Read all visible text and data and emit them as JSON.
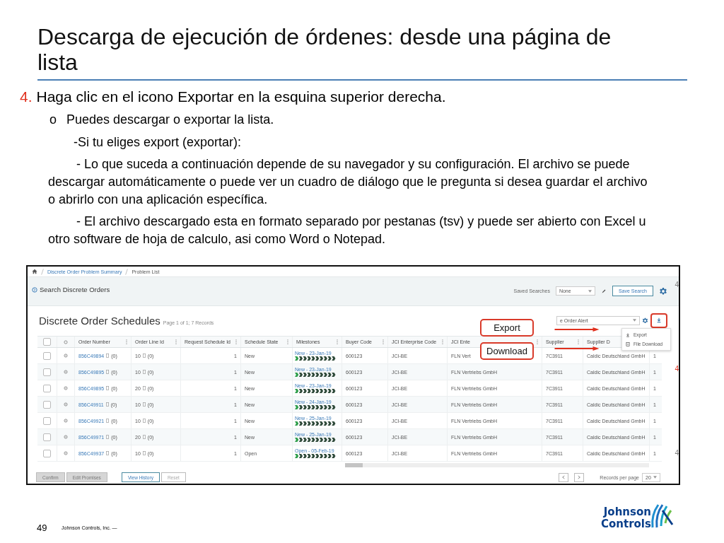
{
  "slide": {
    "title": "Descarga de ejecución de órdenes: desde una página de lista",
    "steps": [
      {
        "kind": "numbered",
        "marker": "4.",
        "text": "Haga clic en el icono Exportar en la esquina superior derecha."
      },
      {
        "kind": "bullet",
        "marker": "o",
        "text": "Puedes descargar o exportar la lista."
      },
      {
        "kind": "indent",
        "text": "-Si tu eliges export (exportar):"
      },
      {
        "kind": "paragraph",
        "text": "- Lo que suceda a continuación depende de su navegador y su configuración. El archivo se puede descargar automáticamente o puede ver un cuadro de diálogo que le pregunta si desea guardar el archivo o abrirlo con una aplicación específica."
      },
      {
        "kind": "paragraph",
        "text": "- El archivo descargado esta en formato separado por pestanas (tsv) y puede ser abierto con Excel u otro software de hoja de calculo, asi como Word o Notepad."
      }
    ]
  },
  "screenshot": {
    "breadcrumbs": [
      "Discrete Order Problem Summary",
      "Problem List"
    ],
    "search_panel": {
      "title": "Search Discrete Orders",
      "saved_searches_label": "Saved Searches",
      "saved_search": "None",
      "save_button": "Save Search"
    },
    "list": {
      "title": "Discrete Order Schedules",
      "page_info": "Page 1 of 1; 7 Records",
      "view_select": "e Order Alert",
      "columns": [
        "Order Number",
        "Order Line Id",
        "Request Schedule Id",
        "Schedule State",
        "Milestones",
        "Buyer Code",
        "JCI Enterprise Code",
        "JCI Ente",
        "Supplier",
        "Supplier D"
      ],
      "header_checked": false,
      "rows": [
        {
          "checked": false,
          "order_number": "856C49894",
          "order_count": "(0)",
          "line_id": "10",
          "line_count": "(0)",
          "request_schedule_id": "1",
          "state": "New",
          "milestone": "New - 23-Jan-19",
          "buyer_code": "600123",
          "enterprise_code": "JCI-BE",
          "enterprise_description": "FLN Vert",
          "supplier": "7C3911",
          "supplier_description": "Caldic Deutschland GmbH",
          "column_13": "1"
        },
        {
          "checked": false,
          "order_number": "856C49895",
          "order_count": "(0)",
          "line_id": "10",
          "line_count": "(0)",
          "request_schedule_id": "1",
          "state": "New",
          "milestone": "New - 23-Jan-19",
          "buyer_code": "600123",
          "enterprise_code": "JCI-BE",
          "enterprise_description": "FLN Vertriebs GmbH",
          "supplier": "7C3911",
          "supplier_description": "Caldic Deutschland GmbH",
          "column_13": "1"
        },
        {
          "checked": false,
          "order_number": "856C49895",
          "order_count": "(0)",
          "line_id": "20",
          "line_count": "(0)",
          "request_schedule_id": "1",
          "state": "New",
          "milestone": "New - 23-Jan-19",
          "buyer_code": "600123",
          "enterprise_code": "JCI-BE",
          "enterprise_description": "FLN Vertriebs GmbH",
          "supplier": "7C3911",
          "supplier_description": "Caldic Deutschland GmbH",
          "column_13": "1"
        },
        {
          "checked": false,
          "order_number": "856C49911",
          "order_count": "(0)",
          "line_id": "10",
          "line_count": "(0)",
          "request_schedule_id": "1",
          "state": "New",
          "milestone": "New - 24-Jan-19",
          "buyer_code": "600123",
          "enterprise_code": "JCI-BE",
          "enterprise_description": "FLN Vertriebs GmbH",
          "supplier": "7C3911",
          "supplier_description": "Caldic Deutschland GmbH",
          "column_13": "1"
        },
        {
          "checked": false,
          "order_number": "856C49921",
          "order_count": "(0)",
          "line_id": "10",
          "line_count": "(0)",
          "request_schedule_id": "1",
          "state": "New",
          "milestone": "New - 25-Jan-19",
          "buyer_code": "600123",
          "enterprise_code": "JCI-BE",
          "enterprise_description": "FLN Vertriebs GmbH",
          "supplier": "7C3911",
          "supplier_description": "Caldic Deutschland GmbH",
          "column_13": "1"
        },
        {
          "checked": false,
          "order_number": "856C49971",
          "order_count": "(0)",
          "line_id": "20",
          "line_count": "(0)",
          "request_schedule_id": "1",
          "state": "New",
          "milestone": "New - 25-Jan-19",
          "buyer_code": "600123",
          "enterprise_code": "JCI-BE",
          "enterprise_description": "FLN Vertriebs GmbH",
          "supplier": "7C3911",
          "supplier_description": "Caldic Deutschland GmbH",
          "column_13": "1"
        },
        {
          "checked": false,
          "order_number": "856C49937",
          "order_count": "(0)",
          "line_id": "10",
          "line_count": "(0)",
          "request_schedule_id": "1",
          "state": "Open",
          "milestone": "Open - 05-Feb-19",
          "buyer_code": "600123",
          "enterprise_code": "JCI-BE",
          "enterprise_description": "FLN Vertriebs GmbH",
          "supplier": "7C3911",
          "supplier_description": "Caldic Deutschland GmbH",
          "column_13": "1"
        }
      ]
    },
    "export_menu": [
      {
        "kind": "export",
        "label": "Export"
      },
      {
        "kind": "download",
        "label": "File Download"
      }
    ],
    "callouts": [
      "Export",
      "Download"
    ],
    "footer_buttons": [
      {
        "kind": "filled",
        "label": "Confirm"
      },
      {
        "kind": "filled",
        "label": "Edit Promises"
      },
      {
        "kind": "outlined",
        "label": "View History"
      },
      {
        "kind": "plain",
        "label": "Reset"
      }
    ],
    "pagination": {
      "records_label": "Records per page",
      "per_page": "20"
    },
    "side_marks": [
      {
        "text": "4",
        "color": "#7f7f7f"
      },
      {
        "text": "4",
        "color": "#e0301e"
      },
      {
        "text": "4",
        "color": "#7f7f7f"
      }
    ]
  },
  "footer": {
    "page": "49",
    "company": "Johnson Controls, Inc. —",
    "logo": [
      "Johnson",
      "Controls"
    ]
  }
}
